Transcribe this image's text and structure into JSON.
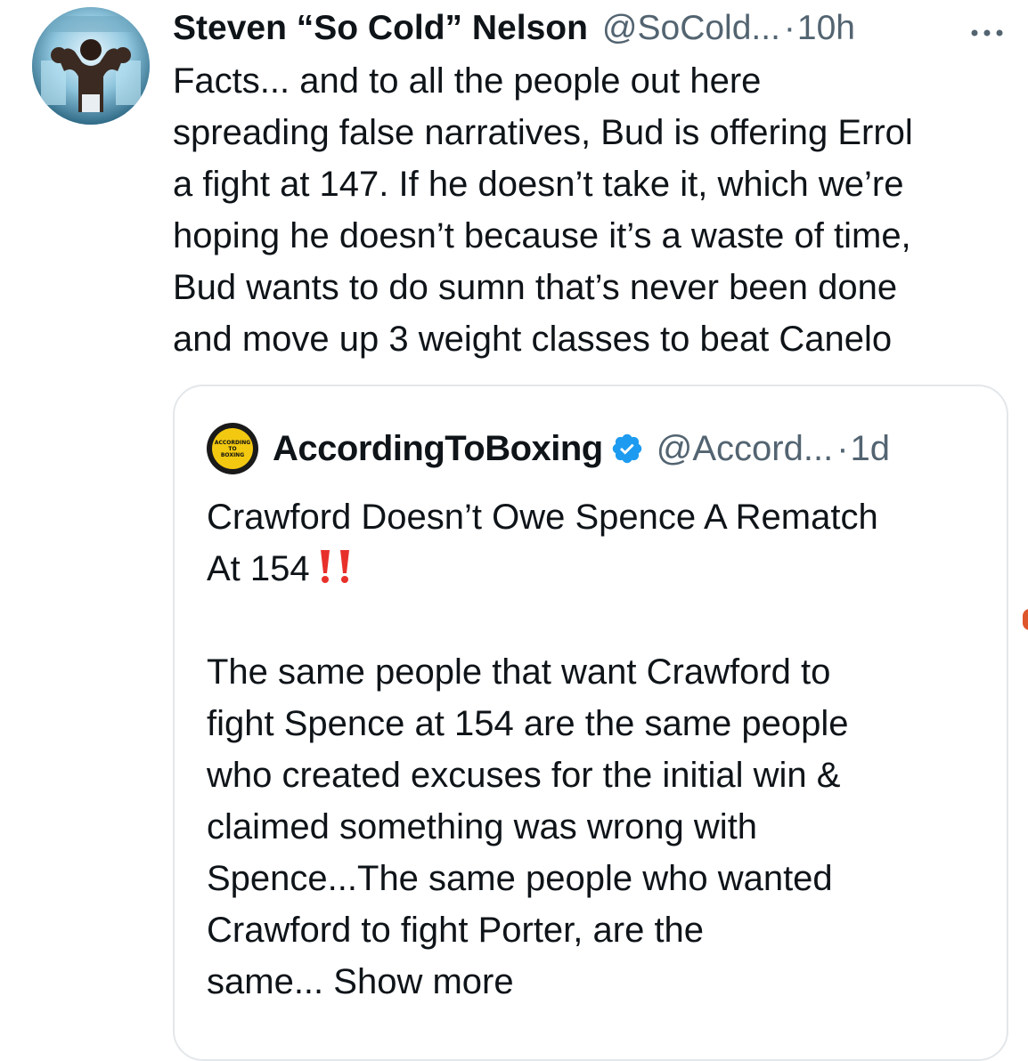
{
  "tweet": {
    "author_name": "Steven “So Cold” Nelson",
    "handle": "@SoCold...",
    "separator": "·",
    "time": "10h",
    "avatar_icon": "boxer-avatar-icon",
    "more_icon": "more-horizontal-icon",
    "text_lines": [
      "Facts... and to all the people out here",
      "spreading false narratives, Bud is offering Errol",
      "a fight at 147. If he doesn’t take it, which we’re",
      "hoping he doesn’t because it’s a waste of time,",
      "Bud wants to do sumn that’s never been done",
      "and move up 3 weight classes to beat Canelo"
    ]
  },
  "quote": {
    "author_name": "AccordingToBoxing",
    "avatar_text": [
      "ACCORDING",
      "TO",
      "BOXING"
    ],
    "verified_icon": "verified-badge-icon",
    "handle": "@Accord...",
    "separator": "·",
    "time": "1d",
    "title_lines": [
      "Crawford Doesn’t Owe Spence A Rematch",
      "At 154"
    ],
    "emoji_icon": "double-exclamation-icon",
    "body_lines": [
      "The same people that want Crawford to",
      "fight Spence at 154 are the same people",
      "who created excuses for the initial win &",
      "claimed something was wrong with",
      "Spence...The same people who wanted",
      "Crawford to fight Porter, are the"
    ],
    "last_line_prefix": "same...",
    "show_more": "Show more"
  },
  "colors": {
    "text": "#0f1419",
    "secondary": "#536471",
    "border": "#e3e7ea",
    "verified": "#1d9bf0",
    "emoji_red": "#e8302b"
  }
}
